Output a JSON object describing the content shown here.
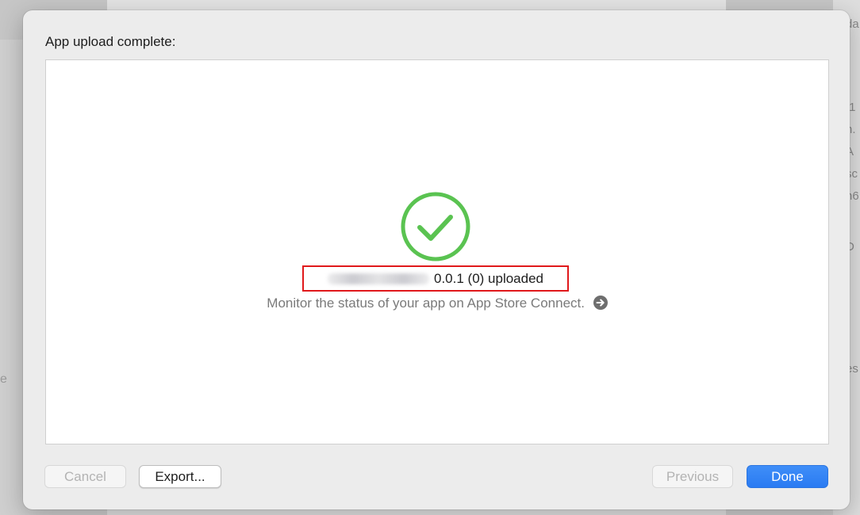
{
  "background": {
    "right_fragments": [
      "da",
      ".1",
      "n.",
      "A",
      "sc",
      "n6",
      "D",
      "es"
    ],
    "left_fragment": "e"
  },
  "sheet": {
    "title": "App upload complete:",
    "status": {
      "app_name": "",
      "text": "0.0.1 (0) uploaded"
    },
    "monitor_text": "Monitor the status of your app on App Store Connect.",
    "buttons": {
      "cancel": "Cancel",
      "export": "Export...",
      "previous": "Previous",
      "done": "Done"
    }
  },
  "colors": {
    "success_green": "#5ac351",
    "highlight_red": "#e0181b",
    "primary_blue": "#2a7bf2"
  },
  "icons": {
    "success": "checkmark-circle-icon",
    "link": "arrow-right-circle-icon"
  }
}
